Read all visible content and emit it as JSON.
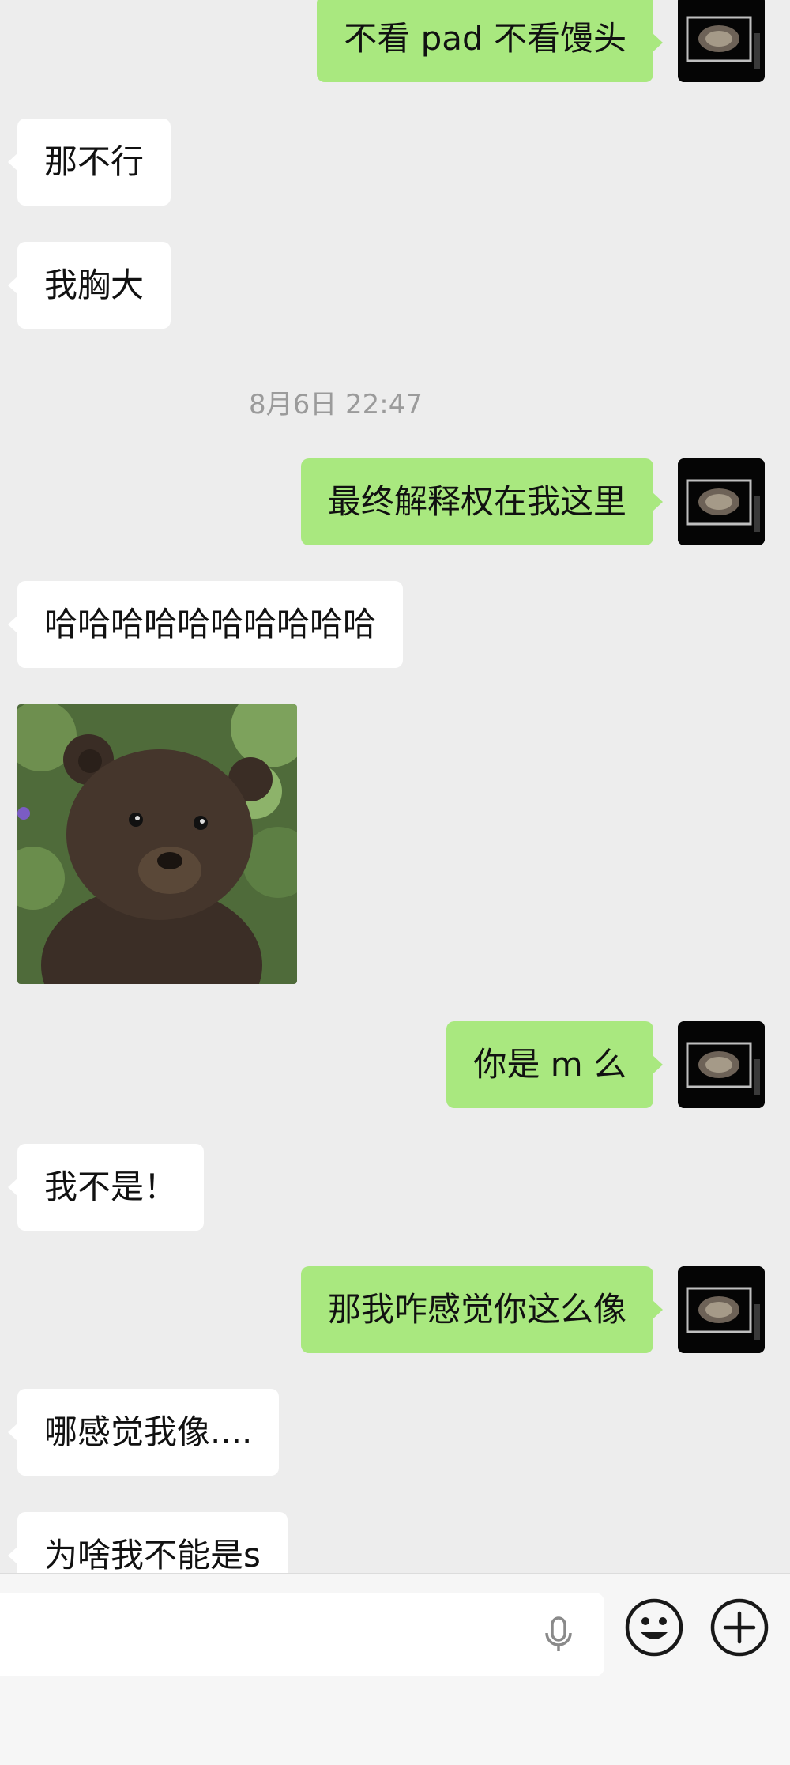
{
  "messages": [
    {
      "side": "out",
      "text": "不看 pad 不看馒头"
    },
    {
      "side": "in",
      "text": "那不行"
    },
    {
      "side": "in",
      "text": "我胸大"
    },
    {
      "type": "time",
      "text": "8月6日 22:47"
    },
    {
      "side": "out",
      "text": "最终解释权在我这里"
    },
    {
      "side": "in",
      "text": "哈哈哈哈哈哈哈哈哈哈"
    },
    {
      "side": "in",
      "type": "image",
      "icon": "bear-cub-photo"
    },
    {
      "side": "out",
      "text": "你是 m 么"
    },
    {
      "side": "in",
      "text": "我不是！"
    },
    {
      "side": "out",
      "text": "那我咋感觉你这么像"
    },
    {
      "side": "in",
      "text": "哪感觉我像...."
    },
    {
      "side": "in",
      "text": "为啥我不能是s"
    }
  ],
  "input_bar": {
    "placeholder": "",
    "icons": [
      "microphone-icon",
      "emoji-icon",
      "plus-icon"
    ]
  },
  "colors": {
    "background": "#ededed",
    "outgoing_bubble": "#a9e87f",
    "incoming_bubble": "#ffffff",
    "timestamp": "#9b9b9b"
  }
}
